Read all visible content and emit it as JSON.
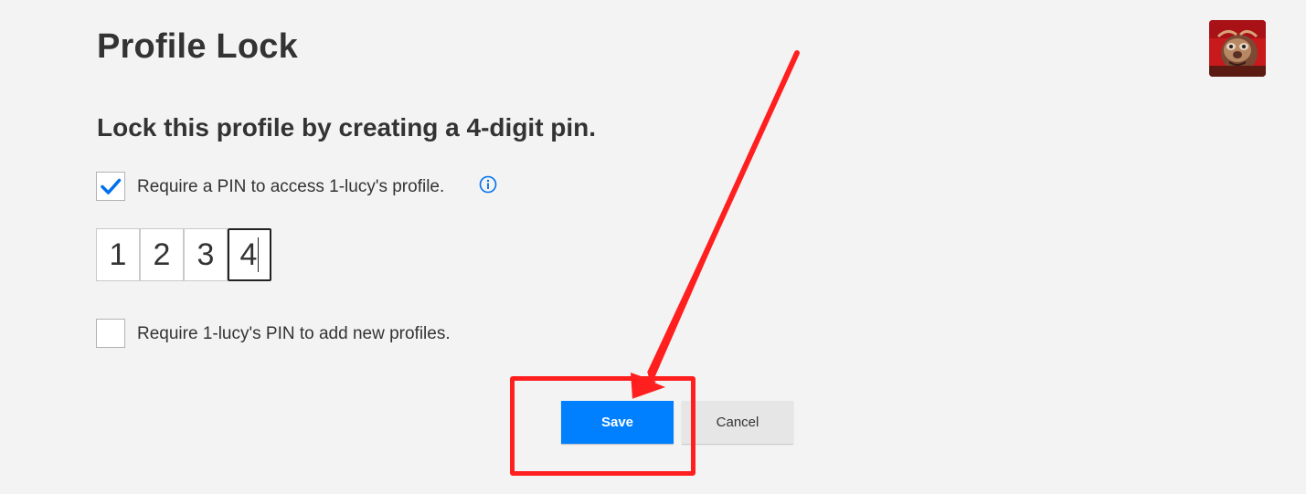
{
  "page": {
    "title": "Profile Lock"
  },
  "avatar": {
    "alt": "profile avatar"
  },
  "lock_section": {
    "heading": "Lock this profile by creating a 4-digit pin.",
    "require_pin": {
      "label": "Require a PIN to access 1-lucy's profile.",
      "checked": true
    },
    "pin_digits": [
      "1",
      "2",
      "3",
      "4"
    ],
    "require_pin_new_profiles": {
      "label": "Require 1-lucy's PIN to add new profiles.",
      "checked": false
    }
  },
  "actions": {
    "save_label": "Save",
    "cancel_label": "Cancel"
  },
  "colors": {
    "background": "#f3f3f3",
    "primary_button": "#0080ff",
    "checkmark": "#0071eb",
    "annotation": "#ff1f1f"
  },
  "icons": {
    "checkbox_checked": "checkmark-icon",
    "info": "info-icon",
    "annotation_arrow": "arrow-icon"
  }
}
